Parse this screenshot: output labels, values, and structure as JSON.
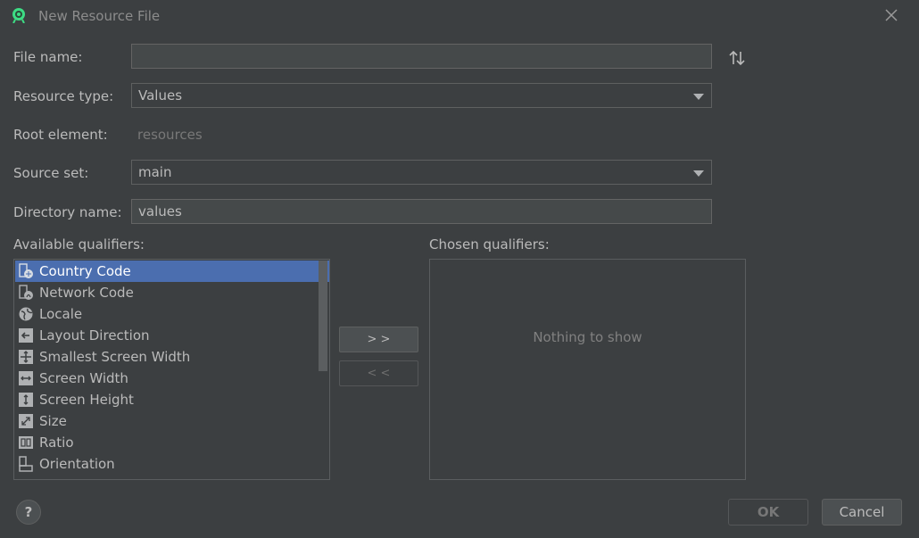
{
  "window": {
    "title": "New Resource File"
  },
  "form": {
    "file_name_label": "File name:",
    "file_name_value": "",
    "resource_type_label": "Resource type:",
    "resource_type_value": "Values",
    "root_element_label": "Root element:",
    "root_element_value": "resources",
    "source_set_label": "Source set:",
    "source_set_value": "main",
    "directory_name_label": "Directory name:",
    "directory_name_value": "values"
  },
  "qualifiers": {
    "available_label": "Available qualifiers:",
    "chosen_label": "Chosen qualifiers:",
    "chosen_empty_text": "Nothing to show",
    "add_button": "> >",
    "remove_button": "< <",
    "items": [
      {
        "label": "Country Code",
        "icon": "country-code-icon",
        "selected": true
      },
      {
        "label": "Network Code",
        "icon": "network-code-icon",
        "selected": false
      },
      {
        "label": "Locale",
        "icon": "globe-icon",
        "selected": false
      },
      {
        "label": "Layout Direction",
        "icon": "layout-direction-icon",
        "selected": false
      },
      {
        "label": "Smallest Screen Width",
        "icon": "smallest-screen-width-icon",
        "selected": false
      },
      {
        "label": "Screen Width",
        "icon": "screen-width-icon",
        "selected": false
      },
      {
        "label": "Screen Height",
        "icon": "screen-height-icon",
        "selected": false
      },
      {
        "label": "Size",
        "icon": "size-icon",
        "selected": false
      },
      {
        "label": "Ratio",
        "icon": "ratio-icon",
        "selected": false
      },
      {
        "label": "Orientation",
        "icon": "orientation-icon",
        "selected": false
      }
    ]
  },
  "footer": {
    "help_label": "?",
    "ok_label": "OK",
    "cancel_label": "Cancel"
  },
  "colors": {
    "background": "#3c3f41",
    "selection": "#4b6eaf",
    "text": "#bbbbbb",
    "icon": "#afb1b3",
    "android_logo": "#3ddc84"
  }
}
